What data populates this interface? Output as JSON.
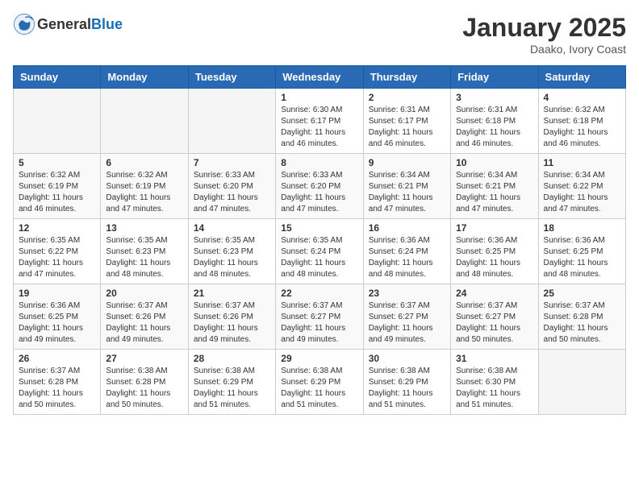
{
  "header": {
    "logo_general": "General",
    "logo_blue": "Blue",
    "month": "January 2025",
    "location": "Daako, Ivory Coast"
  },
  "days_of_week": [
    "Sunday",
    "Monday",
    "Tuesday",
    "Wednesday",
    "Thursday",
    "Friday",
    "Saturday"
  ],
  "weeks": [
    [
      {
        "day": "",
        "sunrise": "",
        "sunset": "",
        "daylight": ""
      },
      {
        "day": "",
        "sunrise": "",
        "sunset": "",
        "daylight": ""
      },
      {
        "day": "",
        "sunrise": "",
        "sunset": "",
        "daylight": ""
      },
      {
        "day": "1",
        "sunrise": "Sunrise: 6:30 AM",
        "sunset": "Sunset: 6:17 PM",
        "daylight": "Daylight: 11 hours and 46 minutes."
      },
      {
        "day": "2",
        "sunrise": "Sunrise: 6:31 AM",
        "sunset": "Sunset: 6:17 PM",
        "daylight": "Daylight: 11 hours and 46 minutes."
      },
      {
        "day": "3",
        "sunrise": "Sunrise: 6:31 AM",
        "sunset": "Sunset: 6:18 PM",
        "daylight": "Daylight: 11 hours and 46 minutes."
      },
      {
        "day": "4",
        "sunrise": "Sunrise: 6:32 AM",
        "sunset": "Sunset: 6:18 PM",
        "daylight": "Daylight: 11 hours and 46 minutes."
      }
    ],
    [
      {
        "day": "5",
        "sunrise": "Sunrise: 6:32 AM",
        "sunset": "Sunset: 6:19 PM",
        "daylight": "Daylight: 11 hours and 46 minutes."
      },
      {
        "day": "6",
        "sunrise": "Sunrise: 6:32 AM",
        "sunset": "Sunset: 6:19 PM",
        "daylight": "Daylight: 11 hours and 47 minutes."
      },
      {
        "day": "7",
        "sunrise": "Sunrise: 6:33 AM",
        "sunset": "Sunset: 6:20 PM",
        "daylight": "Daylight: 11 hours and 47 minutes."
      },
      {
        "day": "8",
        "sunrise": "Sunrise: 6:33 AM",
        "sunset": "Sunset: 6:20 PM",
        "daylight": "Daylight: 11 hours and 47 minutes."
      },
      {
        "day": "9",
        "sunrise": "Sunrise: 6:34 AM",
        "sunset": "Sunset: 6:21 PM",
        "daylight": "Daylight: 11 hours and 47 minutes."
      },
      {
        "day": "10",
        "sunrise": "Sunrise: 6:34 AM",
        "sunset": "Sunset: 6:21 PM",
        "daylight": "Daylight: 11 hours and 47 minutes."
      },
      {
        "day": "11",
        "sunrise": "Sunrise: 6:34 AM",
        "sunset": "Sunset: 6:22 PM",
        "daylight": "Daylight: 11 hours and 47 minutes."
      }
    ],
    [
      {
        "day": "12",
        "sunrise": "Sunrise: 6:35 AM",
        "sunset": "Sunset: 6:22 PM",
        "daylight": "Daylight: 11 hours and 47 minutes."
      },
      {
        "day": "13",
        "sunrise": "Sunrise: 6:35 AM",
        "sunset": "Sunset: 6:23 PM",
        "daylight": "Daylight: 11 hours and 48 minutes."
      },
      {
        "day": "14",
        "sunrise": "Sunrise: 6:35 AM",
        "sunset": "Sunset: 6:23 PM",
        "daylight": "Daylight: 11 hours and 48 minutes."
      },
      {
        "day": "15",
        "sunrise": "Sunrise: 6:35 AM",
        "sunset": "Sunset: 6:24 PM",
        "daylight": "Daylight: 11 hours and 48 minutes."
      },
      {
        "day": "16",
        "sunrise": "Sunrise: 6:36 AM",
        "sunset": "Sunset: 6:24 PM",
        "daylight": "Daylight: 11 hours and 48 minutes."
      },
      {
        "day": "17",
        "sunrise": "Sunrise: 6:36 AM",
        "sunset": "Sunset: 6:25 PM",
        "daylight": "Daylight: 11 hours and 48 minutes."
      },
      {
        "day": "18",
        "sunrise": "Sunrise: 6:36 AM",
        "sunset": "Sunset: 6:25 PM",
        "daylight": "Daylight: 11 hours and 48 minutes."
      }
    ],
    [
      {
        "day": "19",
        "sunrise": "Sunrise: 6:36 AM",
        "sunset": "Sunset: 6:25 PM",
        "daylight": "Daylight: 11 hours and 49 minutes."
      },
      {
        "day": "20",
        "sunrise": "Sunrise: 6:37 AM",
        "sunset": "Sunset: 6:26 PM",
        "daylight": "Daylight: 11 hours and 49 minutes."
      },
      {
        "day": "21",
        "sunrise": "Sunrise: 6:37 AM",
        "sunset": "Sunset: 6:26 PM",
        "daylight": "Daylight: 11 hours and 49 minutes."
      },
      {
        "day": "22",
        "sunrise": "Sunrise: 6:37 AM",
        "sunset": "Sunset: 6:27 PM",
        "daylight": "Daylight: 11 hours and 49 minutes."
      },
      {
        "day": "23",
        "sunrise": "Sunrise: 6:37 AM",
        "sunset": "Sunset: 6:27 PM",
        "daylight": "Daylight: 11 hours and 49 minutes."
      },
      {
        "day": "24",
        "sunrise": "Sunrise: 6:37 AM",
        "sunset": "Sunset: 6:27 PM",
        "daylight": "Daylight: 11 hours and 50 minutes."
      },
      {
        "day": "25",
        "sunrise": "Sunrise: 6:37 AM",
        "sunset": "Sunset: 6:28 PM",
        "daylight": "Daylight: 11 hours and 50 minutes."
      }
    ],
    [
      {
        "day": "26",
        "sunrise": "Sunrise: 6:37 AM",
        "sunset": "Sunset: 6:28 PM",
        "daylight": "Daylight: 11 hours and 50 minutes."
      },
      {
        "day": "27",
        "sunrise": "Sunrise: 6:38 AM",
        "sunset": "Sunset: 6:28 PM",
        "daylight": "Daylight: 11 hours and 50 minutes."
      },
      {
        "day": "28",
        "sunrise": "Sunrise: 6:38 AM",
        "sunset": "Sunset: 6:29 PM",
        "daylight": "Daylight: 11 hours and 51 minutes."
      },
      {
        "day": "29",
        "sunrise": "Sunrise: 6:38 AM",
        "sunset": "Sunset: 6:29 PM",
        "daylight": "Daylight: 11 hours and 51 minutes."
      },
      {
        "day": "30",
        "sunrise": "Sunrise: 6:38 AM",
        "sunset": "Sunset: 6:29 PM",
        "daylight": "Daylight: 11 hours and 51 minutes."
      },
      {
        "day": "31",
        "sunrise": "Sunrise: 6:38 AM",
        "sunset": "Sunset: 6:30 PM",
        "daylight": "Daylight: 11 hours and 51 minutes."
      },
      {
        "day": "",
        "sunrise": "",
        "sunset": "",
        "daylight": ""
      }
    ]
  ]
}
